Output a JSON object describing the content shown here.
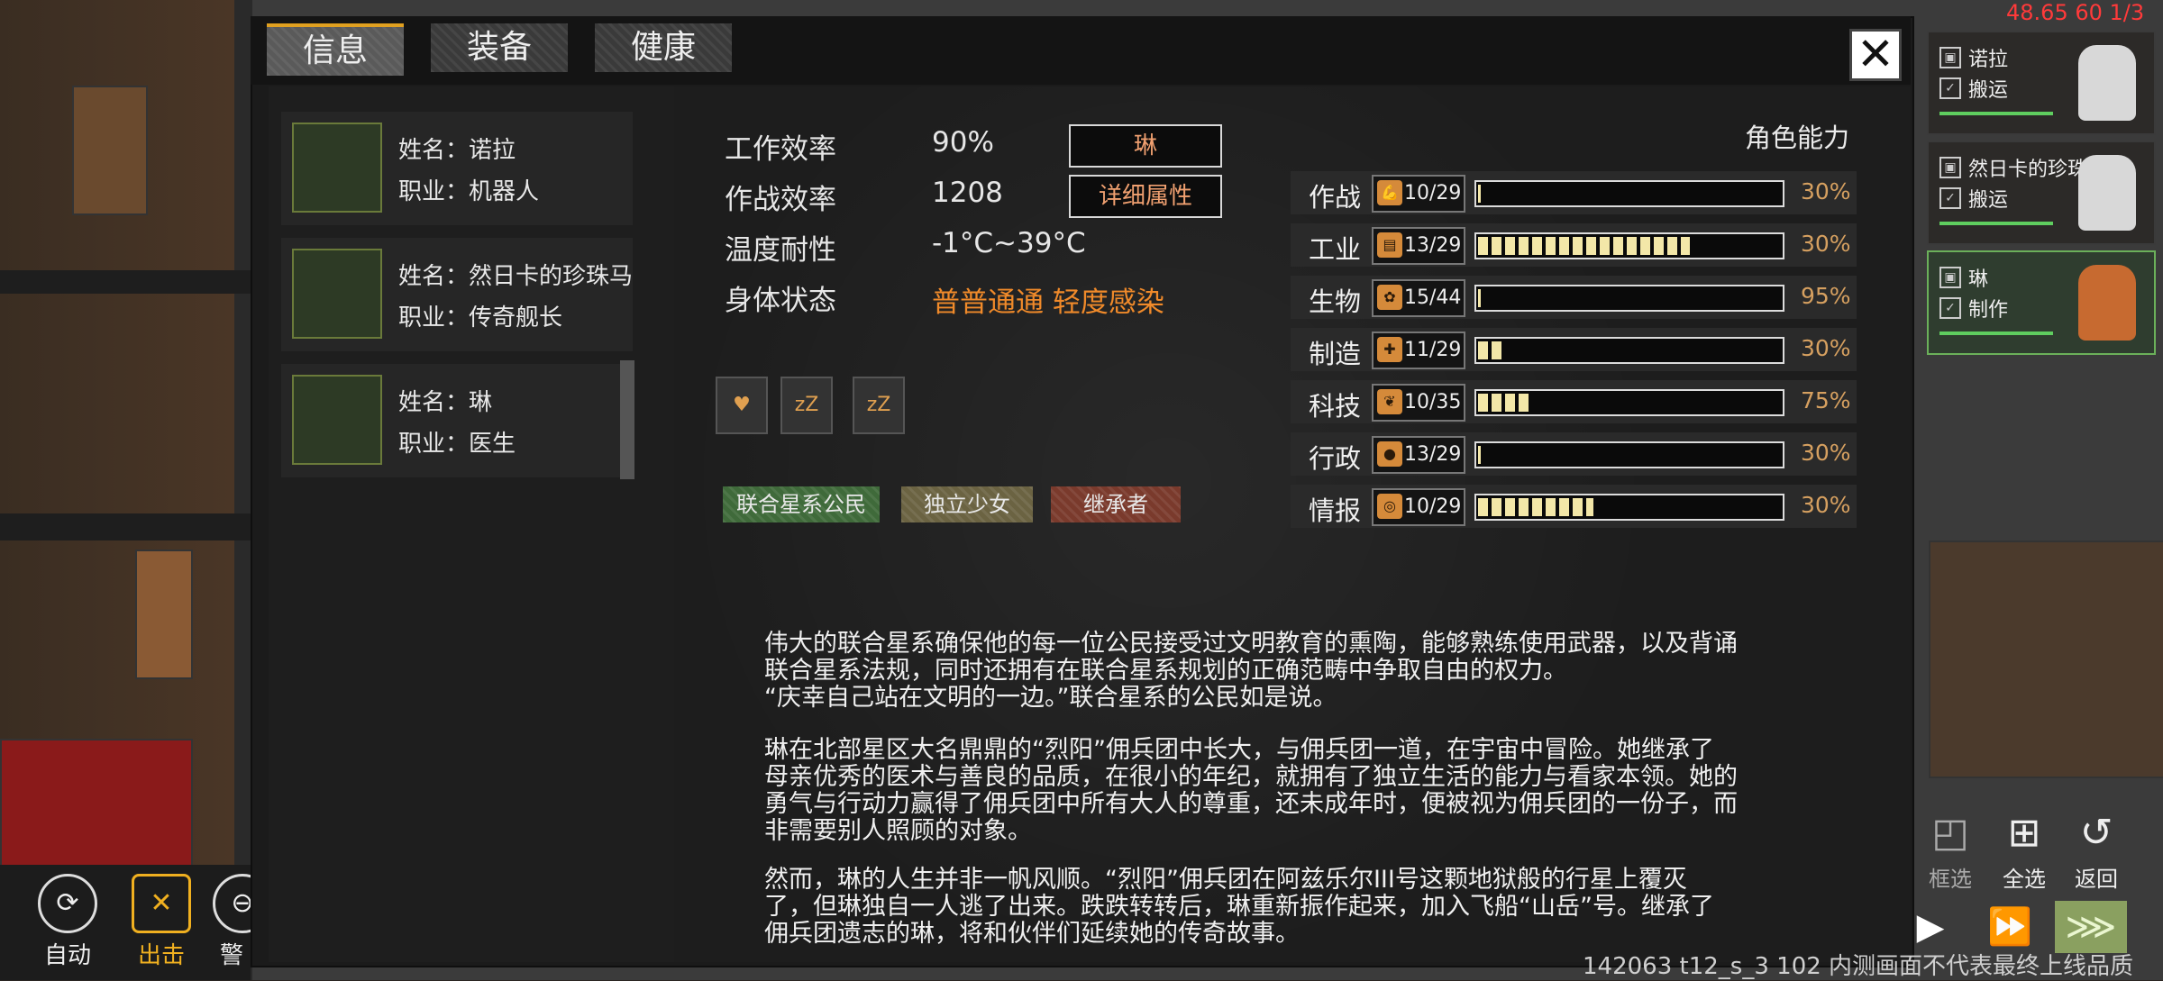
{
  "tabs": [
    {
      "label": "信息",
      "active": true
    },
    {
      "label": "装备",
      "active": false
    },
    {
      "label": "健康",
      "active": false
    }
  ],
  "characters": [
    {
      "name": "姓名：诺拉",
      "job": "职业：机器人"
    },
    {
      "name": "姓名：然日卡的珍珠马",
      "job": "职业：传奇舰长"
    },
    {
      "name": "姓名：琳",
      "job": "职业：医生"
    }
  ],
  "stats": {
    "work_eff_label": "工作效率",
    "work_eff_value": "90%",
    "combat_eff_label": "作战效率",
    "combat_eff_value": "1208",
    "temp_label": "温度耐性",
    "temp_value": "-1°C~39°C",
    "body_label": "身体状态",
    "body_value": "普普通通 轻度感染",
    "name_button": "琳",
    "detail_button": "详细属性"
  },
  "status_icons": [
    "heart-plus-icon",
    "sleep-icon",
    "sleep-icon"
  ],
  "traits": [
    {
      "label": "联合星系公民",
      "color": "#3f6a3a"
    },
    {
      "label": "独立少女",
      "color": "#6b6342"
    },
    {
      "label": "继承者",
      "color": "#7a3a2c"
    }
  ],
  "abilities_title": "角色能力",
  "abilities": [
    {
      "name": "作战",
      "value": "10/29",
      "fill": 0.0,
      "pct": "30%",
      "icon": "arm-icon"
    },
    {
      "name": "工业",
      "value": "13/29",
      "fill": 0.7,
      "pct": "30%",
      "icon": "book-icon"
    },
    {
      "name": "生物",
      "value": "15/44",
      "fill": 0.0,
      "pct": "95%",
      "icon": "paw-icon"
    },
    {
      "name": "制造",
      "value": "11/29",
      "fill": 0.09,
      "pct": "30%",
      "icon": "tools-icon"
    },
    {
      "name": "科技",
      "value": "10/35",
      "fill": 0.17,
      "pct": "75%",
      "icon": "leaf-icon"
    },
    {
      "name": "行政",
      "value": "13/29",
      "fill": 0.0,
      "pct": "30%",
      "icon": "fist-icon"
    },
    {
      "name": "情报",
      "value": "10/29",
      "fill": 0.38,
      "pct": "30%",
      "icon": "target-icon"
    }
  ],
  "description": {
    "p1a": "伟大的联合星系确保他的每一位公民接受过文明教育的熏陶，能够熟练使用武器，以及背诵",
    "p1b": "联合星系法规，同时还拥有在联合星系规划的正确范畴中争取自由的权力。",
    "p1c": "“庆幸自己站在文明的一边。”联合星系的公民如是说。",
    "p2a": "琳在北部星区大名鼎鼎的“烈阳”佣兵团中长大，与佣兵团一道，在宇宙中冒险。她继承了",
    "p2b": "母亲优秀的医术与善良的品质，在很小的年纪，就拥有了独立生活的能力与看家本领。她的",
    "p2c": "勇气与行动力赢得了佣兵团中所有大人的尊重，还未成年时，便被视为佣兵团的一份子，而",
    "p2d": "非需要别人照顾的对象。",
    "p3a": "然而，琳的人生并非一帆风顺。“烈阳”佣兵团在阿兹乐尔III号这颗地狱般的行星上覆灭",
    "p3b": "了，但琳独自一人逃了出来。跌跌转转后，琳重新振作起来，加入飞船“山岳”号。继承了",
    "p3c": "佣兵团遗志的琳，将和伙伴们延续她的传奇故事。"
  },
  "squad": [
    {
      "name": "诺拉",
      "task": "搬运",
      "selected": false
    },
    {
      "name": "然日卡的珍珠马",
      "task": "搬运",
      "selected": false
    },
    {
      "name": "琳",
      "task": "制作",
      "selected": true
    }
  ],
  "bottom_actions": [
    {
      "label": "自动",
      "icon": "auto-icon"
    },
    {
      "label": "出击",
      "icon": "crossed-swords-icon"
    },
    {
      "label": "警",
      "icon": "alert-icon"
    }
  ],
  "right_controls": [
    {
      "label": "框选",
      "icon": "box-select-icon"
    },
    {
      "label": "全选",
      "icon": "select-all-icon"
    },
    {
      "label": "返回",
      "icon": "return-icon"
    }
  ],
  "debug_text": "48.65 60 1/3",
  "watermark": "142063 t12_s_3 102 内测画面不代表最终上线品质"
}
